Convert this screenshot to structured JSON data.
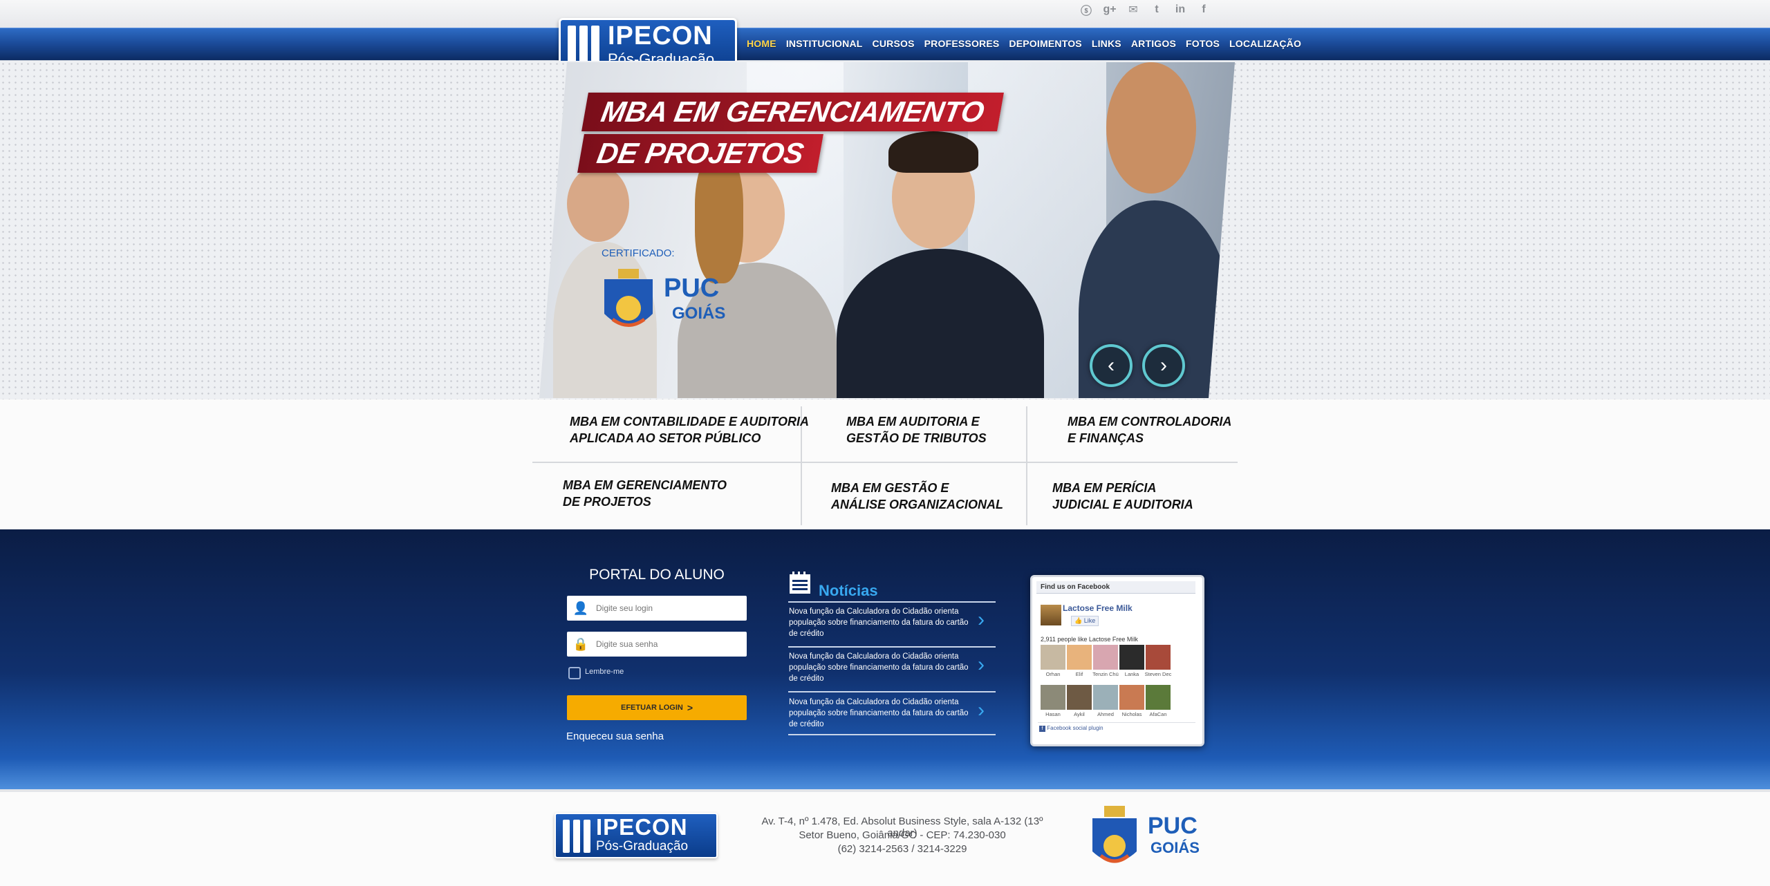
{
  "brand": {
    "name": "IPECON",
    "subtitle": "Pós-Graduação"
  },
  "social_icons": [
    "skype-icon",
    "google-plus-icon",
    "email-icon",
    "twitter-icon",
    "linkedin-icon",
    "facebook-icon"
  ],
  "nav": {
    "items": [
      {
        "label": "HOME",
        "active": true
      },
      {
        "label": "INSTITUCIONAL"
      },
      {
        "label": "CURSOS"
      },
      {
        "label": "PROFESSORES"
      },
      {
        "label": "DEPOIMENTOS"
      },
      {
        "label": "LINKS"
      },
      {
        "label": "ARTIGOS"
      },
      {
        "label": "FOTOS"
      },
      {
        "label": "LOCALIZAÇÃO"
      }
    ]
  },
  "hero": {
    "title_line1": "MBA EM GERENCIAMENTO",
    "title_line2": "DE PROJETOS",
    "certificate_label": "CERTIFICADO:",
    "certificate_name_1": "PUC",
    "certificate_name_2": "GOIÁS",
    "prev_icon": "chevron-left-icon",
    "next_icon": "chevron-right-icon"
  },
  "courses": [
    {
      "line1": "MBA EM CONTABILIDADE E AUDITORIA",
      "line2": "APLICADA AO SETOR PÚBLICO"
    },
    {
      "line1": "MBA EM AUDITORIA E",
      "line2": "GESTÃO DE TRIBUTOS"
    },
    {
      "line1": "MBA EM CONTROLADORIA",
      "line2": "E FINANÇAS"
    },
    {
      "line1": "MBA EM GERENCIAMENTO",
      "line2": "DE PROJETOS"
    },
    {
      "line1": "MBA EM GESTÃO E",
      "line2": "ANÁLISE ORGANIZACIONAL"
    },
    {
      "line1": "MBA EM PERÍCIA",
      "line2": "JUDICIAL E AUDITORIA"
    }
  ],
  "portal": {
    "title": "PORTAL DO ALUNO",
    "login_placeholder": "Digite seu login",
    "password_placeholder": "Digite sua senha",
    "remember_label": "Lembre-me",
    "login_button": "EFETUAR LOGIN",
    "forgot_link": "Enqueceu sua senha"
  },
  "news": {
    "title": "Notícias",
    "items": [
      {
        "text": "Nova função da Calculadora do Cidadão orienta população sobre financiamento da fatura do cartão de crédito"
      },
      {
        "text": "Nova função da Calculadora do Cidadão orienta população sobre financiamento da fatura do cartão de crédito"
      },
      {
        "text": "Nova função da Calculadora do Cidadão orienta população sobre financiamento da fatura do cartão de crédito"
      }
    ]
  },
  "facebook": {
    "header": "Find us on Facebook",
    "page_name": "Lactose Free Milk",
    "like_label": "Like",
    "count_text": "2,911 people like Lactose Free Milk",
    "fans": [
      "Orhan",
      "Elif",
      "Tenzin Chü",
      "Lanka",
      "Steven Dec",
      "Hasan",
      "Aykil",
      "Ahmed",
      "Nicholas",
      "AfaCan"
    ],
    "plugin_label": "Facebook social plugin"
  },
  "footer": {
    "address_line1": "Av. T-4, nº 1.478, Ed. Absolut Business Style, sala A-132 (13º andar)",
    "address_line2": "Setor Bueno, Goiânia/GO - CEP: 74.230-030",
    "phone": "(62) 3214-2563 / 3214-3229",
    "partner_1": "PUC",
    "partner_2": "GOIÁS"
  }
}
